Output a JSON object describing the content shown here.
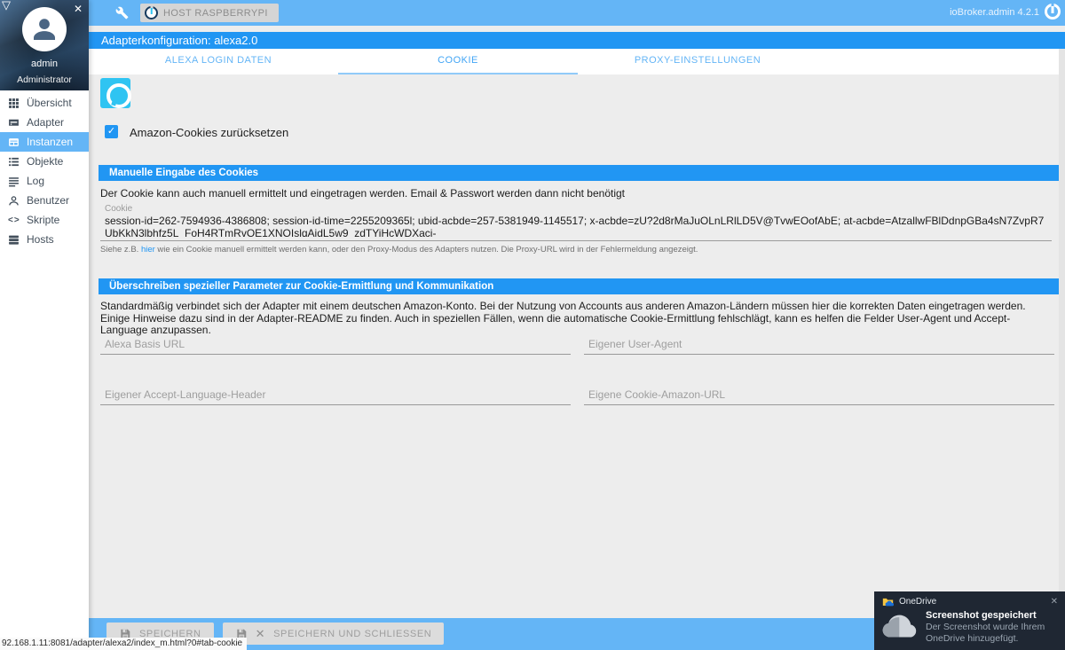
{
  "window": {
    "status_url": "92.168.1.11:8081/adapter/alexa2/index_m.html?0#tab-cookie"
  },
  "topbar": {
    "host_button": "HOST RASPBERRYPI",
    "version": "ioBroker.admin 4.2.1"
  },
  "sidebar": {
    "user": {
      "name": "admin",
      "role": "Administrator"
    },
    "items": [
      {
        "label": "Übersicht",
        "icon": "grid-icon"
      },
      {
        "label": "Adapter",
        "icon": "adapter-icon"
      },
      {
        "label": "Instanzen",
        "icon": "instances-icon",
        "active": true
      },
      {
        "label": "Objekte",
        "icon": "objects-icon"
      },
      {
        "label": "Log",
        "icon": "log-icon"
      },
      {
        "label": "Benutzer",
        "icon": "user-icon"
      },
      {
        "label": "Skripte",
        "icon": "code-icon"
      },
      {
        "label": "Hosts",
        "icon": "hosts-icon"
      }
    ]
  },
  "dialog": {
    "title": "Adapterkonfiguration: alexa2.0",
    "tabs": [
      {
        "label": "ALEXA LOGIN DATEN",
        "active": false
      },
      {
        "label": "COOKIE",
        "active": true
      },
      {
        "label": "PROXY-EINSTELLUNGEN",
        "active": false
      }
    ],
    "checkbox_label": "Amazon-Cookies zurücksetzen",
    "checkbox_checked": true,
    "section1": {
      "title": "Manuelle Eingabe des Cookies",
      "description": "Der Cookie kann auch manuell ermittelt und eingetragen werden. Email & Passwort werden dann nicht benötigt",
      "cookie_label": "Cookie",
      "cookie_value": "session-id=262-7594936-4386808; session-id-time=2255209365l; ubid-acbde=257-5381949-1145517; x-acbde=zU?2d8rMaJuOLnLRlLD5V@TvwEOofAbE; at-acbde=AtzallwFBlDdnpGBa4sN7ZvpR7UbKkN3lbhfz5L_FoH4RTmRvOE1XNOIslqAidL5w9_zdTYiHcWDXaci-",
      "hint_prefix": "Siehe z.B. ",
      "hint_link": "hier",
      "hint_suffix": " wie ein Cookie manuell ermittelt werden kann, oder den Proxy-Modus des Adapters nutzen. Die Proxy-URL wird in der Fehlermeldung angezeigt."
    },
    "section2": {
      "title": "Überschreiben spezieller Parameter zur Cookie-Ermittlung und Kommunikation",
      "description": "Standardmäßig verbindet sich der Adapter mit einem deutschen Amazon-Konto. Bei der Nutzung von Accounts aus anderen Amazon-Ländern müssen hier die korrekten Daten eingetragen werden. Einige Hinweise dazu sind in der Adapter-README zu finden. Auch in speziellen Fällen, wenn die automatische Cookie-Ermittlung fehlschlägt, kann es helfen die Felder User-Agent und Accept-Language anzupassen.",
      "fields": [
        {
          "placeholder": "Alexa Basis URL"
        },
        {
          "placeholder": "Eigener User-Agent"
        },
        {
          "placeholder": "Eigener Accept-Language-Header"
        },
        {
          "placeholder": "Eigene Cookie-Amazon-URL"
        }
      ]
    },
    "footer": {
      "save_label": "SPEICHERN",
      "save_close_label": "SPEICHERN UND SCHLIESSEN"
    }
  },
  "toast": {
    "app": "OneDrive",
    "title": "Screenshot gespeichert",
    "message": "Der Screenshot wurde Ihrem OneDrive hinzugefügt."
  },
  "icons": {
    "triangle": "▽",
    "close": "✕",
    "check": "✓",
    "code": "<>"
  },
  "colors": {
    "topbar": "#64b5f6",
    "accent": "#2196f3",
    "tab_underline": "#90caf9",
    "alexa": "#2fc4f2",
    "toast_bg": "#1f2733"
  }
}
